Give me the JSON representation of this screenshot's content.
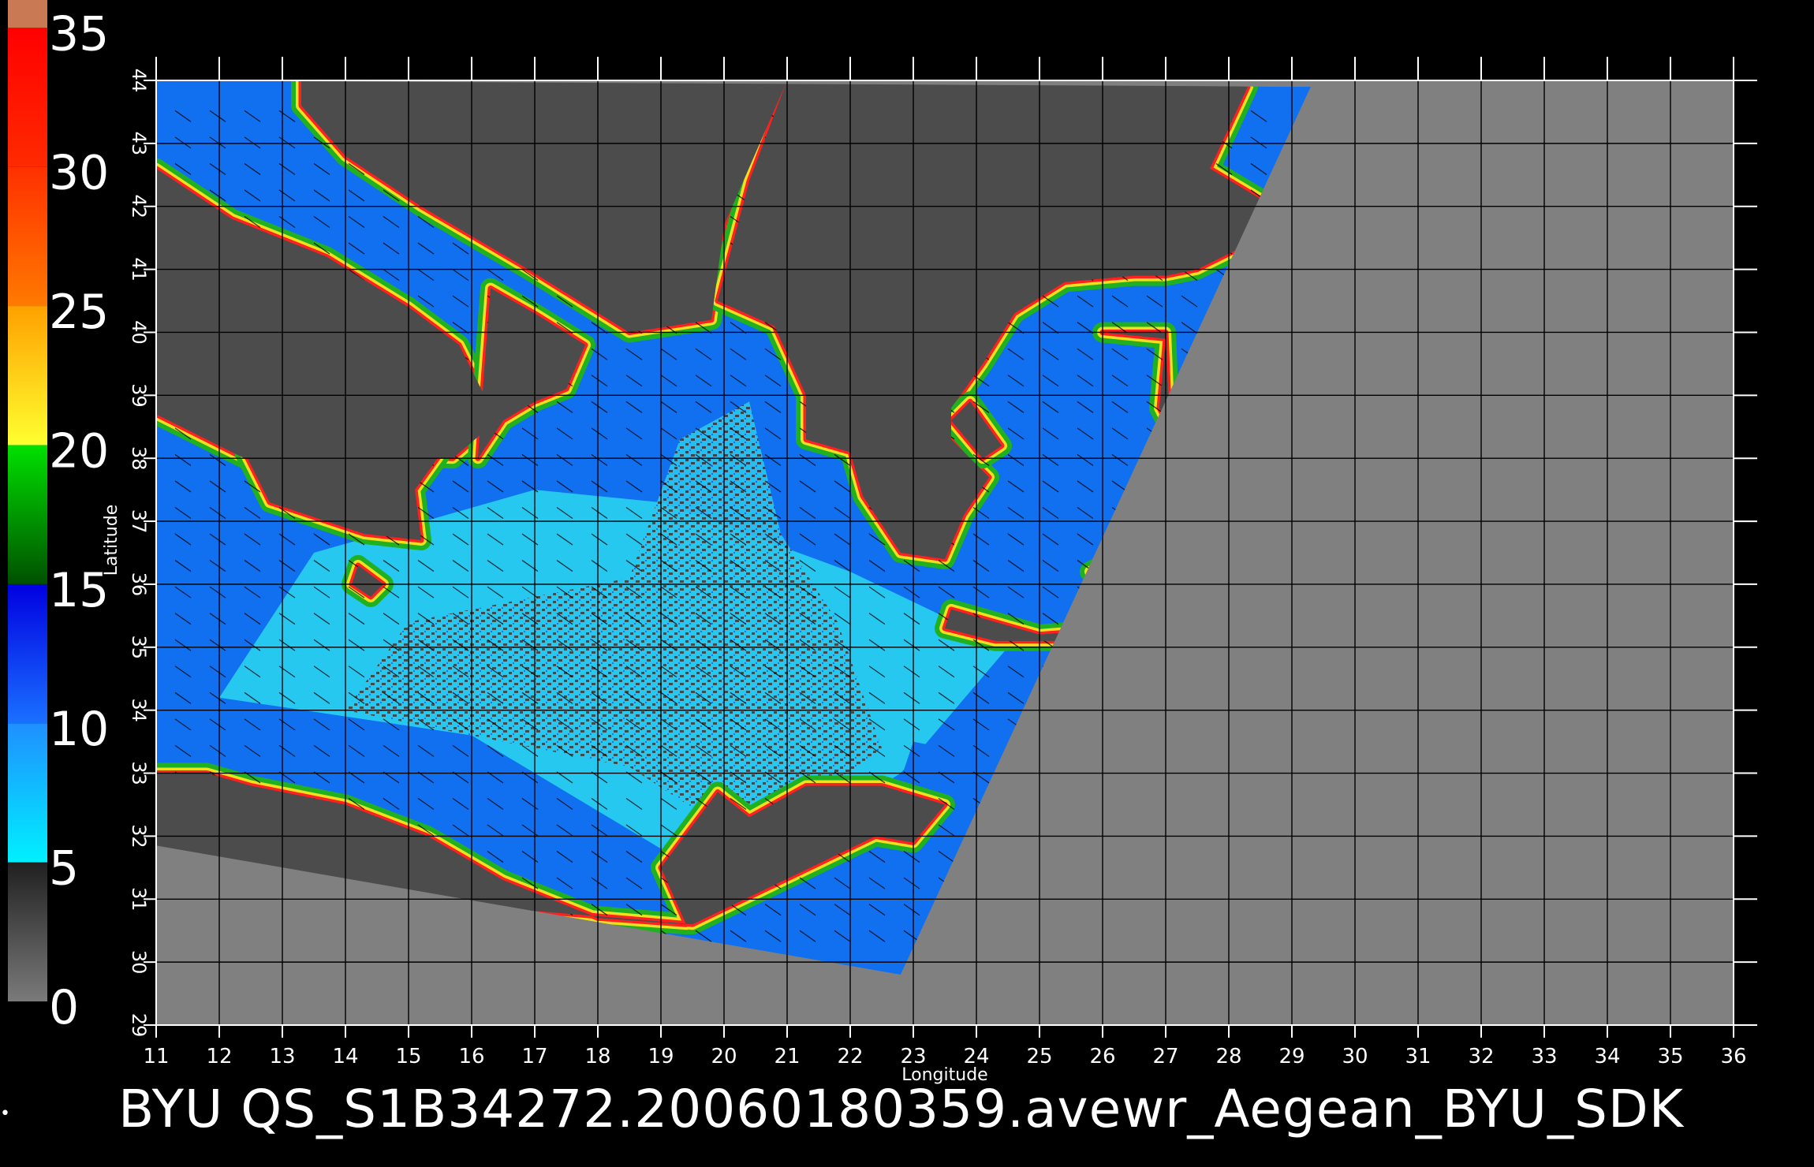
{
  "caption": "BYU  QS_S1B34272.20060180359.avewr_Aegean_BYU_SDK",
  "colorbar": {
    "ticks": [
      0,
      5,
      10,
      15,
      20,
      25,
      30,
      35
    ],
    "bands": [
      {
        "from": 0,
        "to": 5,
        "colors": [
          "#7a7a7a",
          "#202020"
        ]
      },
      {
        "from": 5,
        "to": 10,
        "colors": [
          "#00f0ff",
          "#1f8fff"
        ]
      },
      {
        "from": 10,
        "to": 15,
        "colors": [
          "#1a70ff",
          "#0000e0"
        ]
      },
      {
        "from": 15,
        "to": 20,
        "colors": [
          "#005000",
          "#00e000"
        ]
      },
      {
        "from": 20,
        "to": 25,
        "colors": [
          "#ffff30",
          "#ffa000"
        ]
      },
      {
        "from": 25,
        "to": 30,
        "colors": [
          "#ff7a00",
          "#ff3000"
        ]
      },
      {
        "from": 30,
        "to": 35,
        "colors": [
          "#ff2a00",
          "#ff0000"
        ]
      },
      {
        "from": 35,
        "to": 36,
        "colors": [
          "#c97a55",
          "#c97a55"
        ]
      }
    ]
  },
  "chart_data": {
    "type": "heatmap",
    "title": "",
    "xlabel": "Longitude",
    "ylabel": "Latitude",
    "xlim": [
      11,
      36
    ],
    "ylim": [
      29,
      44
    ],
    "xticks": [
      11,
      12,
      13,
      14,
      15,
      16,
      17,
      18,
      19,
      20,
      21,
      22,
      23,
      24,
      25,
      26,
      27,
      28,
      29,
      30,
      31,
      32,
      33,
      34,
      35,
      36
    ],
    "yticks": [
      29,
      30,
      31,
      32,
      33,
      34,
      35,
      36,
      37,
      38,
      39,
      40,
      41,
      42,
      43,
      44
    ],
    "grid": true,
    "colors": {
      "outside_swath": "#808080",
      "land": "#4c4c4c",
      "low_wind": "#404040",
      "wind_5_10": "#26c8f0",
      "wind_10_15": "#1070f0",
      "coast_green": "#20b020",
      "coast_yellow": "#f0e020",
      "coast_red": "#ff2020"
    },
    "swath_polygon": [
      [
        11,
        31.85
      ],
      [
        22.8,
        29.8
      ],
      [
        29.3,
        43.9
      ],
      [
        11,
        44.0
      ]
    ],
    "land_polygons": [
      [
        [
          13.3,
          44
        ],
        [
          21.0,
          44
        ],
        [
          20.0,
          41.7
        ],
        [
          19.8,
          40.2
        ],
        [
          18.5,
          40.0
        ],
        [
          16.9,
          41.0
        ],
        [
          15.2,
          42.0
        ],
        [
          14.0,
          42.8
        ],
        [
          13.3,
          43.6
        ]
      ],
      [
        [
          11,
          42.6
        ],
        [
          12.2,
          41.8
        ],
        [
          13.7,
          41.2
        ],
        [
          15.0,
          40.4
        ],
        [
          15.8,
          39.8
        ],
        [
          16.4,
          38.6
        ],
        [
          15.7,
          38.0
        ],
        [
          13.0,
          38.1
        ],
        [
          12.4,
          38.0
        ],
        [
          11,
          38.7
        ]
      ],
      [
        [
          16.3,
          40.7
        ],
        [
          17.0,
          40.3
        ],
        [
          17.8,
          39.8
        ],
        [
          17.5,
          39.1
        ],
        [
          17.0,
          38.9
        ],
        [
          16.5,
          38.6
        ],
        [
          16.1,
          38.0
        ],
        [
          16.2,
          39.4
        ]
      ],
      [
        [
          12.4,
          38.1
        ],
        [
          15.6,
          38.2
        ],
        [
          15.1,
          37.5
        ],
        [
          15.2,
          36.7
        ],
        [
          14.3,
          36.8
        ],
        [
          12.8,
          37.3
        ]
      ],
      [
        [
          19.9,
          40.5
        ],
        [
          20.8,
          40.1
        ],
        [
          21.3,
          39.0
        ],
        [
          21.3,
          38.3
        ],
        [
          22.0,
          38.1
        ],
        [
          22.2,
          37.4
        ],
        [
          22.8,
          36.5
        ],
        [
          23.5,
          36.4
        ],
        [
          23.8,
          37.1
        ],
        [
          24.2,
          37.7
        ],
        [
          23.6,
          38.3
        ],
        [
          23.6,
          38.8
        ],
        [
          24.1,
          39.5
        ],
        [
          24.6,
          40.3
        ],
        [
          25.4,
          40.8
        ],
        [
          26.5,
          40.9
        ],
        [
          27.0,
          40.9
        ],
        [
          27.5,
          41.0
        ],
        [
          28.5,
          41.5
        ],
        [
          28.7,
          42.0
        ],
        [
          27.7,
          42.6
        ],
        [
          28.3,
          43.9
        ],
        [
          25.0,
          44
        ],
        [
          21.0,
          44
        ],
        [
          20.4,
          42.4
        ]
      ],
      [
        [
          26.0,
          40.0
        ],
        [
          27.0,
          39.9
        ],
        [
          26.9,
          38.8
        ],
        [
          27.3,
          38.0
        ],
        [
          27.2,
          37.2
        ],
        [
          26.6,
          36.6
        ],
        [
          25.8,
          36.2
        ],
        [
          26.3,
          35.8
        ],
        [
          27.2,
          35.2
        ],
        [
          27.0,
          40.0
        ]
      ],
      [
        [
          19.3,
          31.9
        ],
        [
          20.3,
          32.2
        ],
        [
          20.0,
          31.0
        ],
        [
          19.5,
          30.7
        ]
      ],
      [
        [
          23.6,
          35.6
        ],
        [
          25.0,
          35.2
        ],
        [
          26.3,
          35.3
        ],
        [
          25.8,
          35.1
        ],
        [
          24.3,
          35.1
        ],
        [
          23.5,
          35.3
        ]
      ],
      [
        [
          11,
          33.0
        ],
        [
          11.8,
          33.0
        ],
        [
          12.5,
          32.8
        ],
        [
          14.0,
          32.5
        ],
        [
          15.3,
          32.0
        ],
        [
          16.5,
          31.3
        ],
        [
          18.0,
          30.7
        ],
        [
          19.4,
          30.6
        ],
        [
          19.0,
          31.5
        ],
        [
          19.9,
          32.7
        ],
        [
          20.4,
          32.3
        ],
        [
          21.3,
          32.8
        ],
        [
          22.5,
          32.8
        ],
        [
          23.5,
          32.5
        ],
        [
          23.0,
          31.9
        ],
        [
          22.4,
          32.0
        ],
        [
          19.5,
          30.6
        ],
        [
          16.0,
          30.9
        ],
        [
          11,
          31.85
        ]
      ],
      [
        [
          14.2,
          36.3
        ],
        [
          14.6,
          36.0
        ],
        [
          14.4,
          35.8
        ],
        [
          14.1,
          36.0
        ]
      ],
      [
        [
          23.9,
          38.9
        ],
        [
          24.4,
          38.2
        ],
        [
          24.1,
          38.0
        ],
        [
          23.6,
          38.6
        ]
      ]
    ],
    "wind_speed_regions": [
      {
        "label": "5-10",
        "value": 8,
        "polygon": [
          [
            12.0,
            34.2
          ],
          [
            16.0,
            33.6
          ],
          [
            20.0,
            31.2
          ],
          [
            22.8,
            33.0
          ],
          [
            24.5,
            35.0
          ],
          [
            22.0,
            36.2
          ],
          [
            19.0,
            37.3
          ],
          [
            17.0,
            37.5
          ],
          [
            13.5,
            36.5
          ]
        ]
      },
      {
        "label": "0-5",
        "value": 3,
        "polygon": [
          [
            14.0,
            34.0
          ],
          [
            18.5,
            33.1
          ],
          [
            20.5,
            31.8
          ],
          [
            22.5,
            33.4
          ],
          [
            21.8,
            35.4
          ],
          [
            20.9,
            36.8
          ],
          [
            20.4,
            38.9
          ],
          [
            19.3,
            38.3
          ],
          [
            18.5,
            36.1
          ],
          [
            15.0,
            35.4
          ]
        ]
      },
      {
        "label": "10-15",
        "value": 12,
        "polygon": [
          [
            11.0,
            36.5
          ],
          [
            13.5,
            36.5
          ],
          [
            13.0,
            37.0
          ],
          [
            11.8,
            38.0
          ],
          [
            11.0,
            38.4
          ]
        ]
      },
      {
        "label": "10-15",
        "value": 12,
        "polygon": [
          [
            16.5,
            43.5
          ],
          [
            19.5,
            42.5
          ],
          [
            20.5,
            41.2
          ],
          [
            19.5,
            40.2
          ],
          [
            17.2,
            41.0
          ],
          [
            15.0,
            42.0
          ]
        ]
      },
      {
        "label": "10-15",
        "value": 12,
        "polygon": [
          [
            24.0,
            39.2
          ],
          [
            26.2,
            40.3
          ],
          [
            25.6,
            38.7
          ],
          [
            24.6,
            38.9
          ]
        ]
      },
      {
        "label": "10-15",
        "value": 11,
        "polygon": [
          [
            11.0,
            40.5
          ],
          [
            13.0,
            40.8
          ],
          [
            15.2,
            39.3
          ],
          [
            14.5,
            38.6
          ],
          [
            12.5,
            38.8
          ],
          [
            11.0,
            39.5
          ]
        ]
      },
      {
        "label": "10-15",
        "value": 11,
        "polygon": [
          [
            23.0,
            33.5
          ],
          [
            24.0,
            33.3
          ],
          [
            23.7,
            32.5
          ],
          [
            22.8,
            32.9
          ]
        ]
      }
    ]
  }
}
